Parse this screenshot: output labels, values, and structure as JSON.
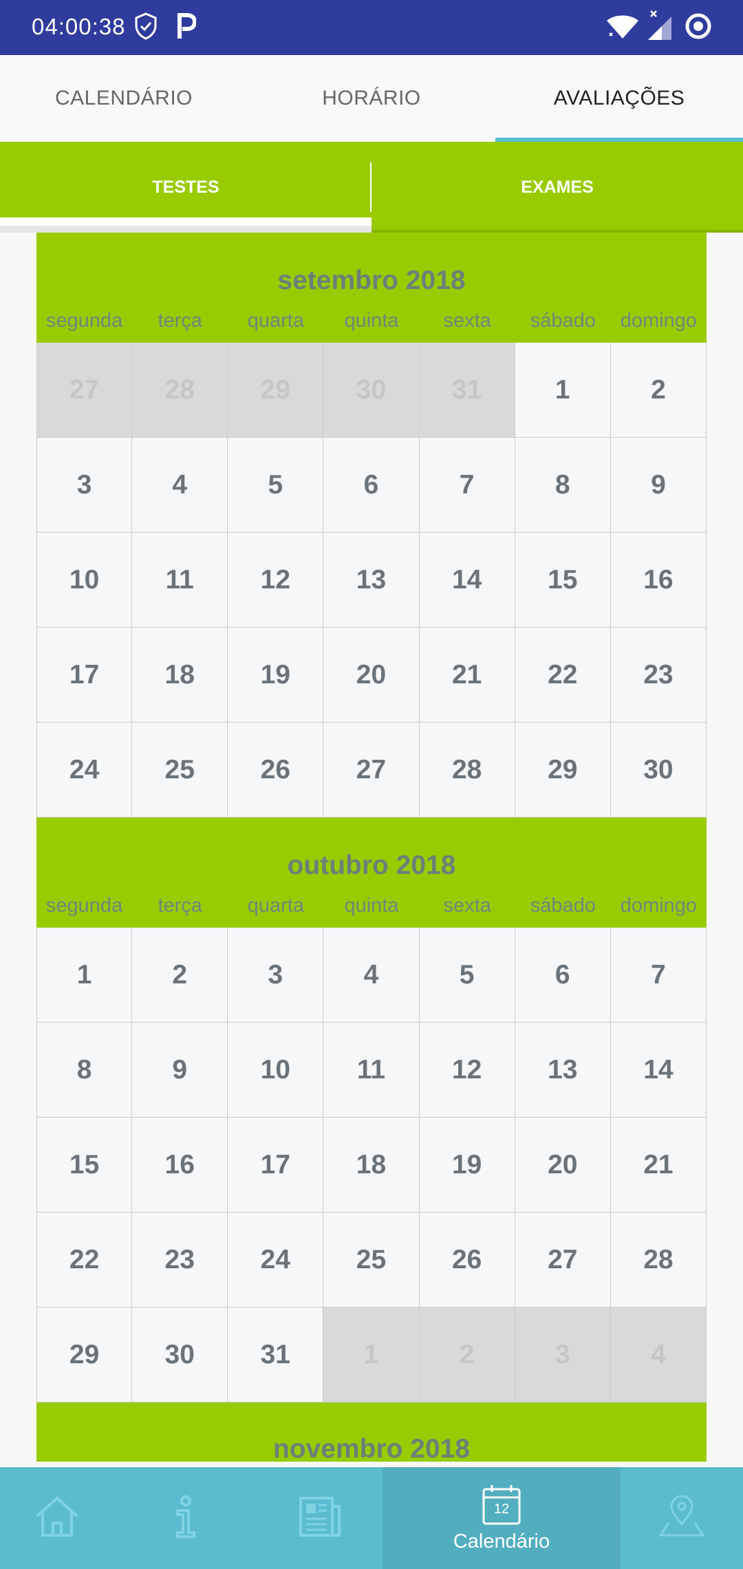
{
  "status_bar": {
    "time": "04:00:38"
  },
  "top_tabs": [
    {
      "label": "CALENDÁRIO"
    },
    {
      "label": "HORÁRIO"
    },
    {
      "label": "AVALIAÇÕES"
    }
  ],
  "sub_tabs": [
    {
      "label": "TESTES"
    },
    {
      "label": "EXAMES"
    }
  ],
  "months": [
    {
      "title": "setembro 2018",
      "weekdays": [
        "segunda",
        "terça",
        "quarta",
        "quinta",
        "sexta",
        "sábado",
        "domingo"
      ],
      "rows": [
        [
          "27",
          "28",
          "29",
          "30",
          "31",
          "1",
          "2"
        ],
        [
          "3",
          "4",
          "5",
          "6",
          "7",
          "8",
          "9"
        ],
        [
          "10",
          "11",
          "12",
          "13",
          "14",
          "15",
          "16"
        ],
        [
          "17",
          "18",
          "19",
          "20",
          "21",
          "22",
          "23"
        ],
        [
          "24",
          "25",
          "26",
          "27",
          "28",
          "29",
          "30"
        ]
      ]
    },
    {
      "title": "outubro 2018",
      "weekdays": [
        "segunda",
        "terça",
        "quarta",
        "quinta",
        "sexta",
        "sábado",
        "domingo"
      ],
      "rows": [
        [
          "1",
          "2",
          "3",
          "4",
          "5",
          "6",
          "7"
        ],
        [
          "8",
          "9",
          "10",
          "11",
          "12",
          "13",
          "14"
        ],
        [
          "15",
          "16",
          "17",
          "18",
          "19",
          "20",
          "21"
        ],
        [
          "22",
          "23",
          "24",
          "25",
          "26",
          "27",
          "28"
        ],
        [
          "29",
          "30",
          "31",
          "1",
          "2",
          "3",
          "4"
        ]
      ]
    },
    {
      "title": "novembro 2018"
    }
  ],
  "bottom_nav": {
    "calendar_icon_day": "12",
    "active_label": "Calendário"
  }
}
